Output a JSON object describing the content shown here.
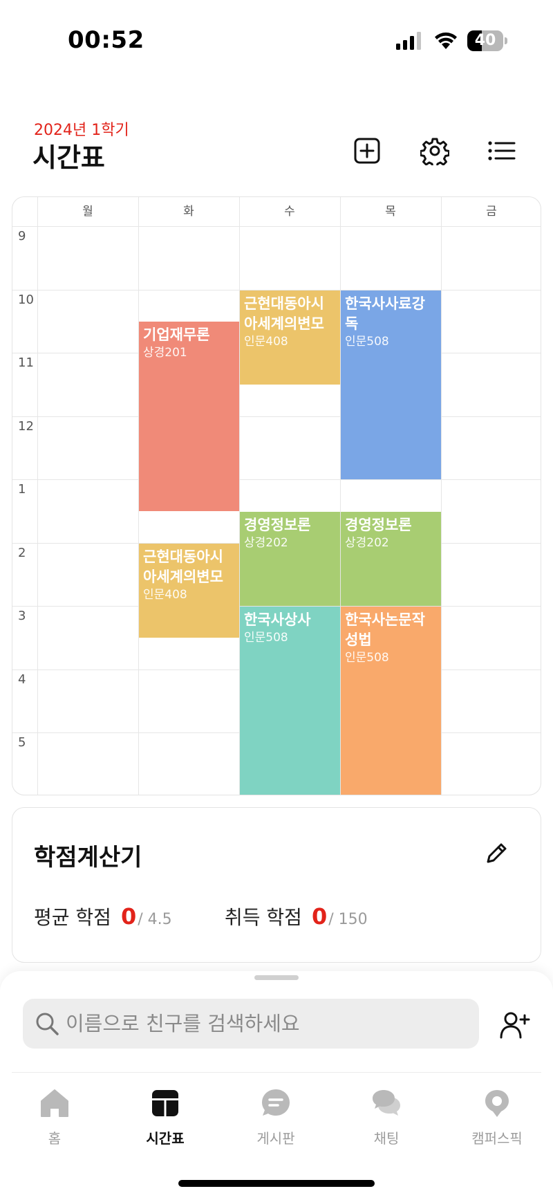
{
  "status_bar": {
    "time": "00:52",
    "battery_level": "40",
    "icons": [
      "signal-icon",
      "wifi-icon",
      "battery-icon"
    ]
  },
  "header": {
    "semester": "2024년 1학기",
    "title": "시간표",
    "actions": [
      "add-icon",
      "gear-icon",
      "list-icon"
    ]
  },
  "timetable": {
    "days": [
      "월",
      "화",
      "수",
      "목",
      "금"
    ],
    "hours": [
      "9",
      "10",
      "11",
      "12",
      "1",
      "2",
      "3",
      "4",
      "5"
    ],
    "courses": [
      {
        "title": "기업재무론",
        "room": "상경201",
        "day": "화",
        "start": "10:30",
        "end": "13:30",
        "color": "#f08a78"
      },
      {
        "title": "근현대동아시아세계의변모",
        "room": "인문408",
        "day": "화",
        "start": "14:00",
        "end": "15:30",
        "color": "#ecc46a"
      },
      {
        "title": "근현대동아시아세계의변모",
        "room": "인문408",
        "day": "수",
        "start": "10:00",
        "end": "11:30",
        "color": "#ecc46a"
      },
      {
        "title": "경영정보론",
        "room": "상경202",
        "day": "수",
        "start": "13:30",
        "end": "15:00",
        "color": "#a8cd72"
      },
      {
        "title": "한국사상사",
        "room": "인문508",
        "day": "수",
        "start": "15:00",
        "end": "18:00",
        "color": "#7fd3c2"
      },
      {
        "title": "한국사사료강독",
        "room": "인문508",
        "day": "목",
        "start": "10:00",
        "end": "13:00",
        "color": "#7aa6e6"
      },
      {
        "title": "경영정보론",
        "room": "상경202",
        "day": "목",
        "start": "13:30",
        "end": "15:00",
        "color": "#a8cd72"
      },
      {
        "title": "한국사논문작성법",
        "room": "인문508",
        "day": "목",
        "start": "15:00",
        "end": "18:00",
        "color": "#f9a96b"
      }
    ]
  },
  "credit_calculator": {
    "title": "학점계산기",
    "average_label": "평균 학점",
    "average_value": "0",
    "average_max": "/ 4.5",
    "earned_label": "취득 학점",
    "earned_value": "0",
    "earned_max": "/ 150"
  },
  "friend_search": {
    "placeholder": "이름으로 친구를 검색하세요"
  },
  "tab_bar": {
    "tabs": [
      {
        "label": "홈",
        "icon": "home-icon",
        "active": false
      },
      {
        "label": "시간표",
        "icon": "timetable-icon",
        "active": true
      },
      {
        "label": "게시판",
        "icon": "board-icon",
        "active": false
      },
      {
        "label": "채팅",
        "icon": "chat-icon",
        "active": false
      },
      {
        "label": "캠퍼스픽",
        "icon": "campuspick-icon",
        "active": false
      }
    ]
  },
  "colors": {
    "accent_red": "#e2231a",
    "tab_inactive": "#9c9c9c"
  }
}
